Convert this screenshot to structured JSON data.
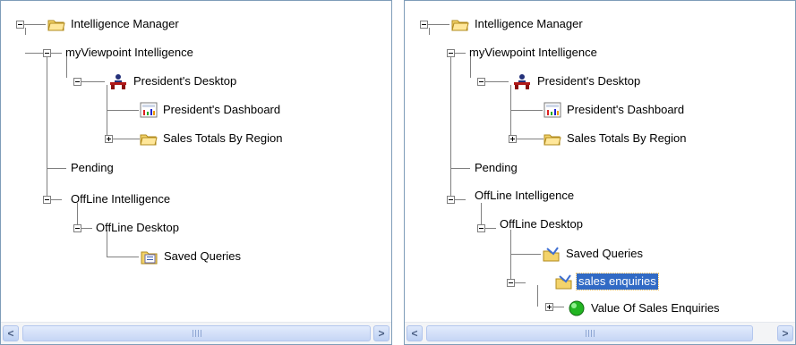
{
  "left_tree": {
    "root": "Intelligence Manager",
    "my_viewpoint": "myViewpoint Intelligence",
    "presidents_desktop": "President's Desktop",
    "presidents_dashboard": "President's Dashboard",
    "sales_totals": "Sales Totals By Region",
    "pending": "Pending",
    "offline_intelligence": "OffLine Intelligence",
    "offline_desktop": "OffLine Desktop",
    "saved_queries": "Saved Queries"
  },
  "right_tree": {
    "root": "Intelligence Manager",
    "my_viewpoint": "myViewpoint Intelligence",
    "presidents_desktop": "President's Desktop",
    "presidents_dashboard": "President's Dashboard",
    "sales_totals": "Sales Totals By Region",
    "pending": "Pending",
    "offline_intelligence": "OffLine Intelligence",
    "offline_desktop": "OffLine Desktop",
    "saved_queries": "Saved Queries",
    "sales_enquiries": "sales enquiries",
    "value_of_sales_enquiries": "Value Of Sales Enquiries"
  },
  "scroll": {
    "left_arrow": "<",
    "right_arrow": ">"
  }
}
